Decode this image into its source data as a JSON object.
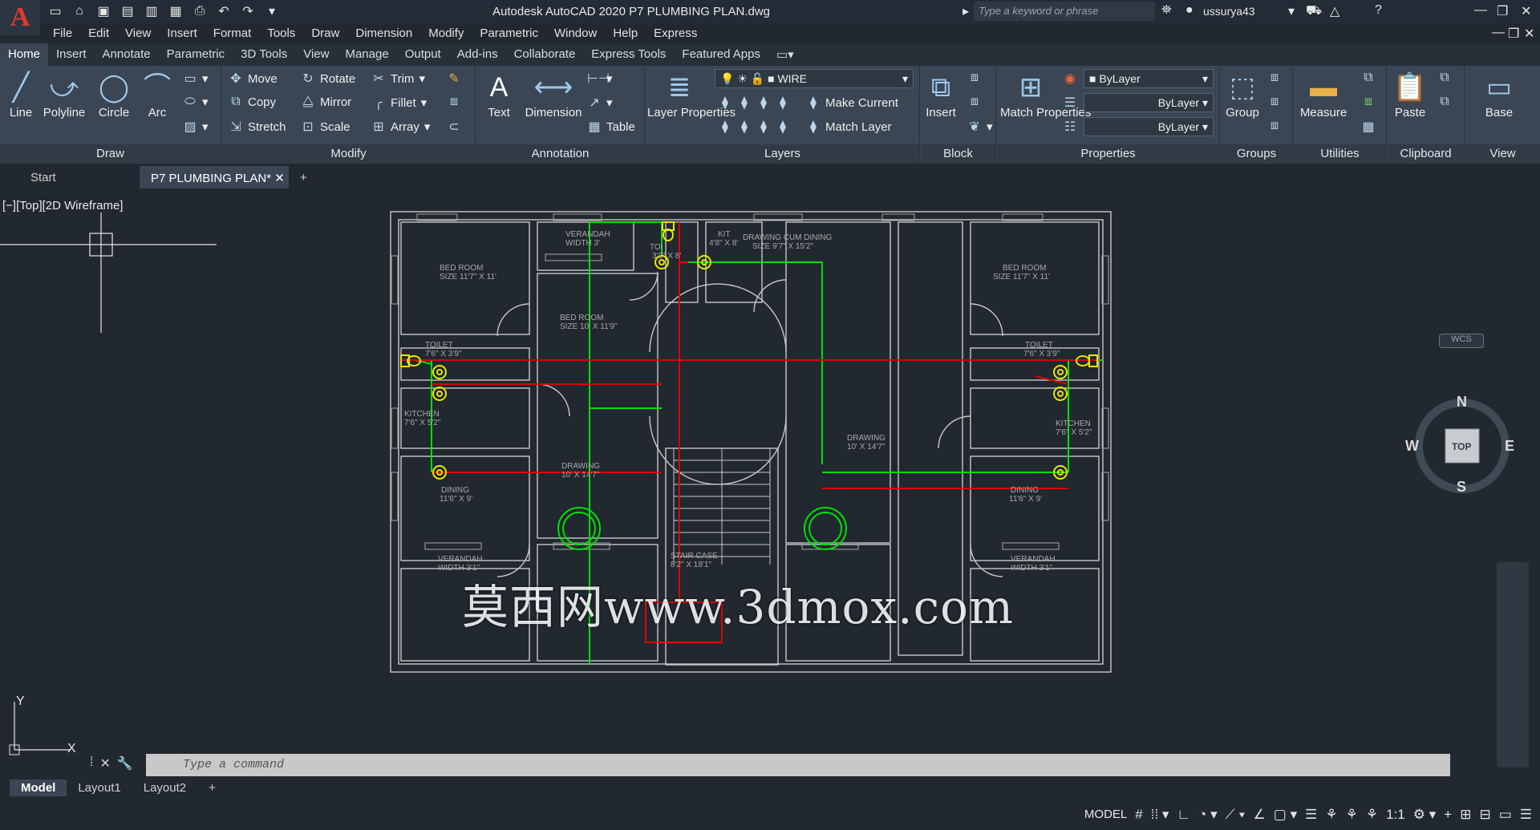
{
  "app": {
    "logo_letter": "A",
    "window_title": "Autodesk AutoCAD 2020    P7 PLUMBING PLAN.dwg",
    "search_placeholder": "Type a keyword or phrase",
    "username": "ussurya43"
  },
  "menu": [
    "File",
    "Edit",
    "View",
    "Insert",
    "Format",
    "Tools",
    "Draw",
    "Dimension",
    "Modify",
    "Parametric",
    "Window",
    "Help",
    "Express"
  ],
  "ribbon_tabs": [
    "Home",
    "Insert",
    "Annotate",
    "Parametric",
    "3D Tools",
    "View",
    "Manage",
    "Output",
    "Add-ins",
    "Collaborate",
    "Express Tools",
    "Featured Apps"
  ],
  "ribbon": {
    "draw": {
      "title": "Draw",
      "line": "Line",
      "polyline": "Polyline",
      "circle": "Circle",
      "arc": "Arc"
    },
    "modify": {
      "title": "Modify",
      "move": "Move",
      "rotate": "Rotate",
      "trim": "Trim",
      "copy": "Copy",
      "mirror": "Mirror",
      "fillet": "Fillet",
      "stretch": "Stretch",
      "scale": "Scale",
      "array": "Array"
    },
    "annotation": {
      "title": "Annotation",
      "text": "Text",
      "dimension": "Dimension",
      "table": "Table"
    },
    "layers": {
      "title": "Layers",
      "layer_properties": "Layer Properties",
      "current_layer": "WIRE",
      "make_current": "Make Current",
      "match_layer": "Match Layer"
    },
    "block": {
      "title": "Block",
      "insert": "Insert"
    },
    "properties": {
      "title": "Properties",
      "match_properties": "Match Properties",
      "color": "ByLayer",
      "linetype": "ByLayer",
      "lineweight": "ByLayer"
    },
    "groups": {
      "title": "Groups",
      "group": "Group"
    },
    "utilities": {
      "title": "Utilities",
      "measure": "Measure"
    },
    "clipboard": {
      "title": "Clipboard",
      "paste": "Paste"
    },
    "view": {
      "title": "View",
      "base": "Base"
    }
  },
  "doc_tabs": {
    "start": "Start",
    "active": "P7 PLUMBING PLAN*"
  },
  "viewport_label": "[−][Top][2D Wireframe]",
  "viewcube": {
    "n": "N",
    "s": "S",
    "e": "E",
    "w": "W",
    "top": "TOP",
    "wcs": "WCS"
  },
  "ucs": {
    "y": "Y",
    "x": "X"
  },
  "command": {
    "placeholder": "Type a command"
  },
  "layout_tabs": [
    "Model",
    "Layout1",
    "Layout2"
  ],
  "status": {
    "model": "MODEL",
    "scale": "1:1"
  },
  "watermark": "莫西网www.3dmox.com",
  "plan_labels": {
    "verandah_top": "VERANDAH\nWIDTH 3'",
    "bed_left": "BED ROOM\nSIZE 11'7\" X 11'",
    "bed_mid": "BED ROOM\nSIZE 10' X 11'9\"",
    "kit": "KIT\n4'8\" X 8'",
    "toi": "TOI\n3'3\" X 8'",
    "drawing_dining": "DRAWING CUM DINING\nSIZE 9'7\" X 15'2\"",
    "bed_right": "BED ROOM\nSIZE 11'7\" X 11'",
    "toilet_left": "TOILET\n7'6\" X 3'9\"",
    "toilet_right": "TOILET\n7'6\" X 3'9\"",
    "kitchen_left": "KITCHEN\n7'6\" X 5'2\"",
    "kitchen_right": "KITCHEN\n7'6\" X 5'2\"",
    "drawing_left": "DRAWING\n10' X 14'7\"",
    "drawing_right": "DRAWING\n10' X 14'7\"",
    "dining_left": "DINING\n11'6\" X 9'",
    "dining_right": "DINING\n11'6\" X 9'",
    "verandah_bl": "VERANDAH\nWIDTH 3'1\"",
    "verandah_br": "VERANDAH\nWIDTH 3'1\"",
    "staircase": "STAIR CASE\n8'2\" X 18'1\""
  },
  "colors": {
    "wire": "#00e000",
    "pipe": "#e00000",
    "fixture": "#e8e800",
    "wall": "#c8c8c8",
    "background": "#212830"
  }
}
